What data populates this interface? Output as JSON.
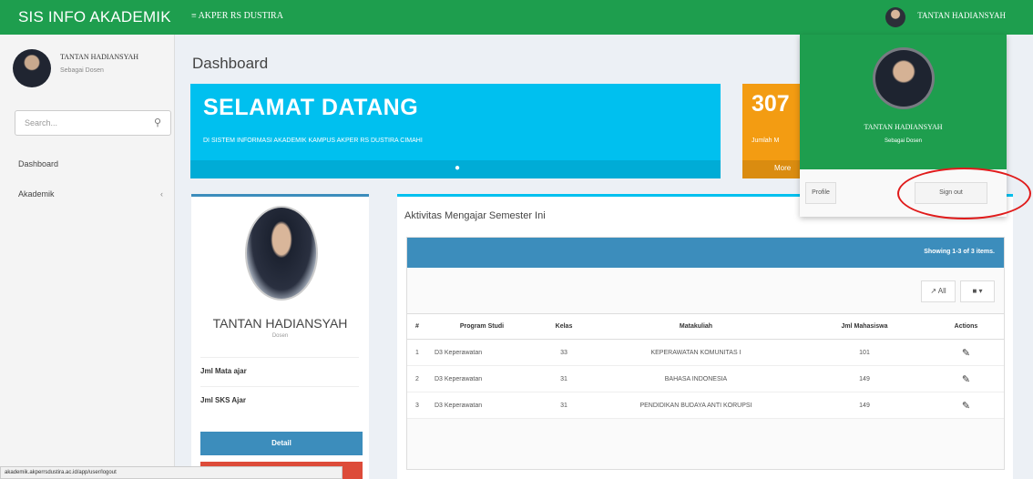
{
  "topbar": {
    "brand": "SIS INFO AKADEMIK",
    "menu": "≡ AKPER RS DUSTIRA",
    "user": "TANTAN HADIANSYAH"
  },
  "sidebar": {
    "user_name": "TANTAN HADIANSYAH",
    "user_role": "Sebagai Dosen",
    "search_placeholder": "Search...",
    "nav": [
      {
        "label": "Dashboard"
      },
      {
        "label": "Akademik"
      }
    ]
  },
  "main": {
    "title": "Dashboard",
    "welcome": {
      "heading": "SELAMAT DATANG",
      "subtitle": "DI SISTEM INFORMASI AKADEMIK KAMPUS AKPER RS DUSTIRA CIMAHI"
    },
    "stat": {
      "value": "307",
      "label": "Jumlah M",
      "more": "More"
    },
    "profile": {
      "name": "TANTAN HADIANSYAH",
      "role": "Dosen",
      "rows": [
        "Jml Mata ajar",
        "Jml SKS Ajar"
      ],
      "detail_button": "Detail"
    },
    "activity": {
      "heading": "Aktivitas Mengajar Semester Ini",
      "summary": "Showing 1-3 of 3 items.",
      "all_button": "All",
      "columns": [
        "#",
        "Program Studi",
        "Kelas",
        "Matakuliah",
        "Jml Mahasiswa",
        "Actions"
      ],
      "rows": [
        {
          "no": "1",
          "prodi": "D3 Keperawatan",
          "kelas": "33",
          "mk": "KEPERAWATAN KOMUNITAS I",
          "jml": "101"
        },
        {
          "no": "2",
          "prodi": "D3 Keperawatan",
          "kelas": "31",
          "mk": "BAHASA INDONESIA",
          "jml": "149"
        },
        {
          "no": "3",
          "prodi": "D3 Keperawatan",
          "kelas": "31",
          "mk": "PENDIDIKAN BUDAYA ANTI KORUPSI",
          "jml": "149"
        }
      ]
    }
  },
  "dropdown": {
    "name": "TANTAN HADIANSYAH",
    "role": "Sebagai Dosen",
    "profile_button": "Profile",
    "signout_button": "Sign out"
  },
  "statusbar": {
    "url": "akademik.akperrsdustira.ac.id/app/user/logout"
  },
  "colors": {
    "topbar": "#1e9e4e",
    "welcome": "#00c0ef",
    "stat": "#f39c12",
    "primary": "#3c8dbc",
    "annotation": "#e01b1b"
  }
}
